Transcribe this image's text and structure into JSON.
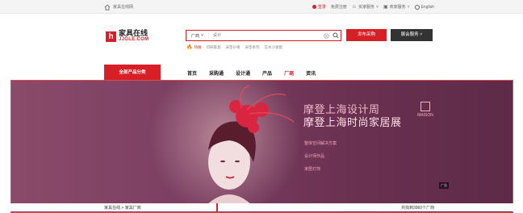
{
  "topbar": {
    "home_text": "家具在线网",
    "login_label": "登录",
    "register_label": "免费注册",
    "buyer_center": "买家服务",
    "seller_center": "商家服务",
    "english": "English"
  },
  "logo": {
    "mark": "h",
    "name_cn": "家具在线",
    "name_en": "JJGLE.COM"
  },
  "search": {
    "category": "厂商",
    "placeholder": "设计",
    "hot_label": "热搜",
    "hot_terms": [
      "印刷家具",
      "床垫价格",
      "床垫系列",
      "实木沙发套"
    ]
  },
  "buttons": {
    "post_purchase": "发布采购",
    "exhibition_service": "展会服务"
  },
  "nav": {
    "category_button": "全部产品分类",
    "items": [
      "首页",
      "采购通",
      "设计通",
      "产品",
      "厂商",
      "资讯"
    ],
    "active_index": 4
  },
  "banner": {
    "title_line1": "摩登上海设计周",
    "title_line2": "摩登上海时尚家居展",
    "brand": "MAISON",
    "links": [
      "整体空间解决方案",
      "设计师作品",
      "家居灯饰"
    ],
    "ad_tag": "广告"
  },
  "breadcrumb": {
    "text": "家具在线 > 家具厂商"
  },
  "results": {
    "text": "共找到3960个厂商"
  },
  "colors": {
    "brand_red": "#d61f26",
    "banner_bg": "#7b3f62",
    "dark_button": "#333333"
  }
}
